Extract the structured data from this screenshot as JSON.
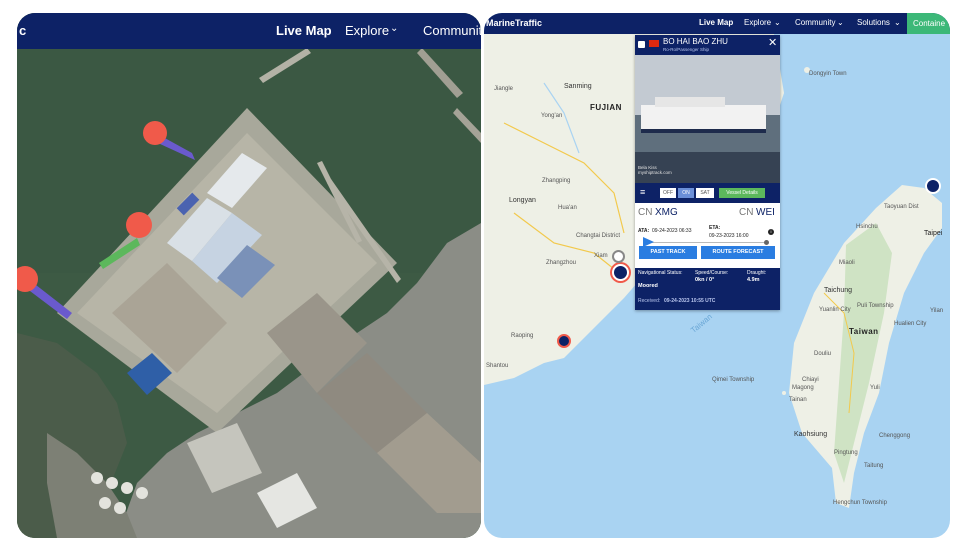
{
  "left_panel": {
    "nav": {
      "brand_fragment": "c",
      "live_map": "Live Map",
      "explore": "Explore",
      "community": "Community"
    }
  },
  "right_panel": {
    "nav": {
      "brand": "MarineTraffic",
      "live_map": "Live Map",
      "explore": "Explore",
      "community": "Community",
      "solutions": "Solutions",
      "containers": "Containe"
    },
    "map_labels": {
      "sanming": "Sanming",
      "fujian": "FUJIAN",
      "yongan": "Yong'an",
      "jiangle": "Jiangle",
      "zhangping": "Zhangping",
      "longyan": "Longyan",
      "hua_an": "Hua'an",
      "changtai": "Changtai District",
      "xiamen": "Xiam",
      "zhangzhou": "Zhangzhou",
      "raoping": "Raoping",
      "shantou": "Shantou",
      "taiwan_strait": "Taiwan",
      "dongyin": "Dongyin Town",
      "taoyuan": "Taoyuan Dist",
      "taipei": "Taipei",
      "hsinchu": "Hsinchu",
      "miaoli": "Miaoli",
      "taichung": "Taichung",
      "yuanlin": "Yuanlin City",
      "puli": "Puli Township",
      "taiwan": "Taiwan",
      "douliu": "Douliu",
      "chiayi": "Chiayi",
      "tainan": "Tainan",
      "kaohsiung": "Kaohsiung",
      "taitung": "Taitung",
      "hualien": "Hualien City",
      "chenggong": "Chenggong",
      "yuli": "Yuli",
      "qimei": "Qimei Township",
      "pingtung": "Pingtung",
      "hengchun": "Hengchun Township",
      "yilan": "Yilan",
      "magong": "Magong"
    },
    "popup": {
      "flag": "CN",
      "vessel_name": "BO HAI BAO ZHU",
      "vessel_type": "Ro-Ro/Passenger Ship",
      "photo_credit": "Bela Kiss\nmyshiptrack.com",
      "toggles": [
        "OFF",
        "ON",
        "SAT"
      ],
      "vessel_details": "Vessel Details",
      "origin_country": "CN",
      "origin_port": "XMG",
      "dest_country": "CN",
      "dest_port": "WEI",
      "ata_label": "ATA:",
      "ata_value": "09-24-2023 06:33",
      "eta_label": "ETA:",
      "eta_value": "09-23-2023 16:00",
      "past_track": "PAST TRACK",
      "route_forecast": "ROUTE FORECAST",
      "nav_status_label": "Navigational Status:",
      "nav_status_value": "Moored",
      "speed_label": "Speed/Course:",
      "speed_value": "0kn / 0°",
      "draught_label": "Draught:",
      "draught_value": "4.9m",
      "received_label": "Received:",
      "received_value": "09-24-2023 10:55 UTC"
    }
  },
  "colors": {
    "nav_bg": "#0d2266",
    "sea": "#a9d3f2",
    "land": "#eef0e6",
    "vessel_green": "#5cb85c",
    "button_blue": "#2a7de1"
  }
}
